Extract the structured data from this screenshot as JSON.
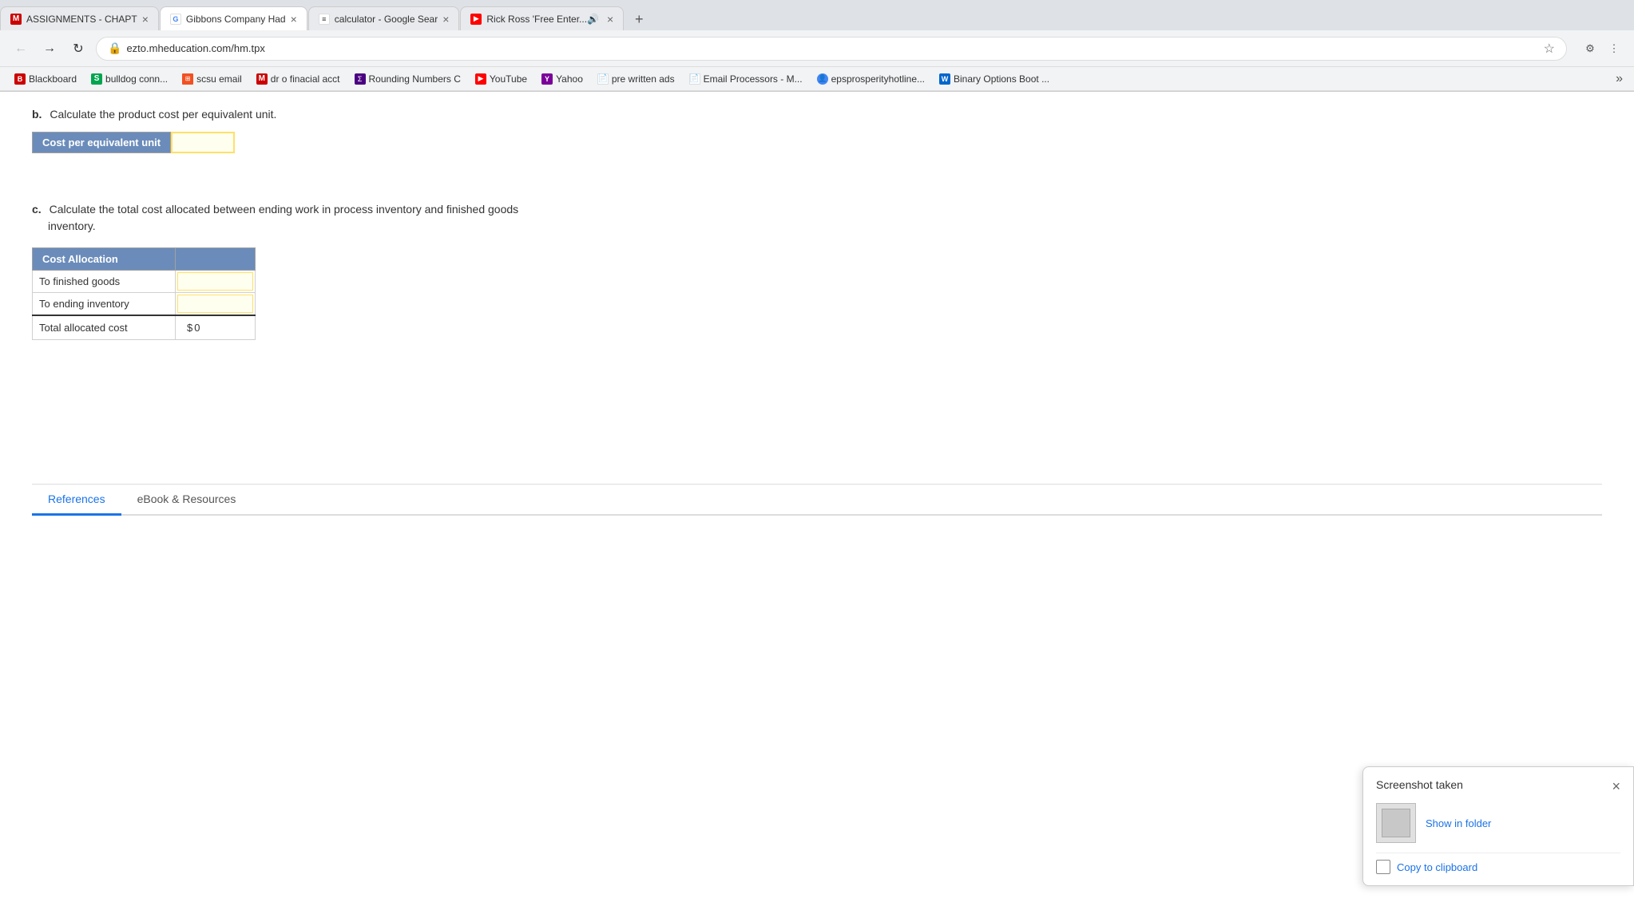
{
  "browser": {
    "tabs": [
      {
        "id": "tab1",
        "favicon_type": "fav-m",
        "favicon_label": "M",
        "title": "ASSIGNMENTS - CHAPT",
        "active": false,
        "has_close": true
      },
      {
        "id": "tab2",
        "favicon_type": "fav-g",
        "favicon_label": "G",
        "title": "Gibbons Company Had",
        "active": true,
        "has_close": true
      },
      {
        "id": "tab3",
        "favicon_type": "fav-calc",
        "favicon_label": "≡",
        "title": "calculator - Google Sear",
        "active": false,
        "has_close": true
      },
      {
        "id": "tab4",
        "favicon_type": "fav-yt",
        "favicon_label": "▶",
        "title": "Rick Ross 'Free Enter...",
        "active": false,
        "has_close": true,
        "audio": true
      }
    ],
    "address_url": "ezto.mheducation.com/hm.tpx",
    "bookmarks": [
      {
        "id": "bm1",
        "favicon_type": "fav-bb",
        "favicon_label": "B",
        "label": "Blackboard"
      },
      {
        "id": "bm2",
        "favicon_type": "fav-s",
        "favicon_label": "S",
        "label": "bulldog conn..."
      },
      {
        "id": "bm3",
        "favicon_type": "fav-ms",
        "favicon_label": "⊞",
        "label": "scsu email"
      },
      {
        "id": "bm4",
        "favicon_type": "fav-m",
        "favicon_label": "M",
        "label": "dr o finacial acct"
      },
      {
        "id": "bm5",
        "favicon_type": "fav-sum",
        "favicon_label": "Σ",
        "label": "Rounding Numbers C"
      },
      {
        "id": "bm6",
        "favicon_type": "fav-yt",
        "favicon_label": "▶",
        "label": "YouTube"
      },
      {
        "id": "bm7",
        "favicon_type": "fav-y",
        "favicon_label": "Y",
        "label": "Yahoo"
      },
      {
        "id": "bm8",
        "favicon_type": "fav-doc",
        "favicon_label": "📄",
        "label": "pre written ads"
      },
      {
        "id": "bm9",
        "favicon_type": "fav-doc",
        "favicon_label": "📄",
        "label": "Email Processors - M..."
      },
      {
        "id": "bm10",
        "favicon_type": "fav-person",
        "favicon_label": "👤",
        "label": "epsprosperityhotline..."
      },
      {
        "id": "bm11",
        "favicon_type": "fav-w",
        "favicon_label": "W",
        "label": "Binary Options Boot ..."
      }
    ]
  },
  "section_b": {
    "label": "b.",
    "instruction": "Calculate the product cost per equivalent unit.",
    "table": {
      "label_cell": "Cost per equivalent unit",
      "input_value": ""
    }
  },
  "section_c": {
    "label": "c.",
    "instruction_line1": "Calculate the total cost allocated between ending work in process inventory and finished goods",
    "instruction_line2": "inventory.",
    "table": {
      "header1": "Cost Allocation",
      "header2": "",
      "rows": [
        {
          "label": "To finished goods",
          "value": ""
        },
        {
          "label": "To ending inventory",
          "value": ""
        }
      ],
      "total_label": "Total allocated cost",
      "total_dollar": "$",
      "total_value": "0"
    }
  },
  "references": {
    "tabs": [
      {
        "id": "ref-tab",
        "label": "References",
        "active": true
      },
      {
        "id": "ebook-tab",
        "label": "eBook & Resources",
        "active": false
      }
    ]
  },
  "screenshot_notification": {
    "title": "Screenshot taken",
    "show_in_folder": "Show in folder",
    "copy_label": "Copy to clipboard",
    "close_label": "×"
  }
}
